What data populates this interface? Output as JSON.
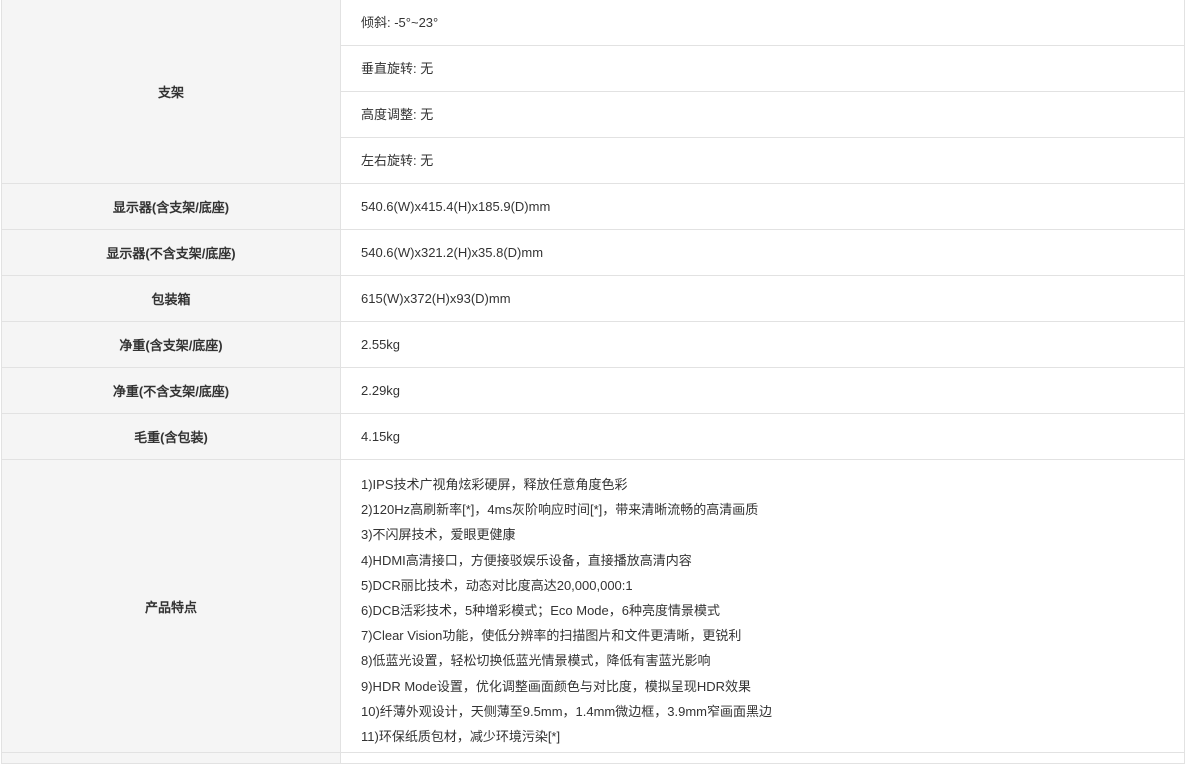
{
  "rows": [
    {
      "label": "支架",
      "values": [
        "倾斜: -5°~23°",
        "垂直旋转: 无",
        "高度调整: 无",
        "左右旋转: 无"
      ]
    },
    {
      "label": "显示器(含支架/底座)",
      "value": "540.6(W)x415.4(H)x185.9(D)mm"
    },
    {
      "label": "显示器(不含支架/底座)",
      "value": "540.6(W)x321.2(H)x35.8(D)mm"
    },
    {
      "label": "包装箱",
      "value": "615(W)x372(H)x93(D)mm"
    },
    {
      "label": "净重(含支架/底座)",
      "value": "2.55kg"
    },
    {
      "label": "净重(不含支架/底座)",
      "value": "2.29kg"
    },
    {
      "label": "毛重(含包装)",
      "value": "4.15kg"
    },
    {
      "label": "产品特点",
      "values": [
        "1)IPS技术广视角炫彩硬屏，释放任意角度色彩",
        "2)120Hz高刷新率[*]，4ms灰阶响应时间[*]，带来清晰流畅的高清画质",
        "3)不闪屏技术，爱眼更健康",
        "4)HDMI高清接口，方便接驳娱乐设备，直接播放高清内容",
        "5)DCR丽比技术，动态对比度高达20,000,000:1",
        "6)DCB活彩技术，5种增彩模式；Eco Mode，6种亮度情景模式",
        "7)Clear Vision功能，使低分辨率的扫描图片和文件更清晰，更锐利",
        "8)低蓝光设置，轻松切换低蓝光情景模式，降低有害蓝光影响",
        "9)HDR Mode设置，优化调整画面颜色与对比度，模拟呈现HDR效果",
        "10)纤薄外观设计，天侧薄至9.5mm，1.4mm微边框，3.9mm窄画面黑边",
        "11)环保纸质包材，减少环境污染[*]"
      ]
    }
  ]
}
